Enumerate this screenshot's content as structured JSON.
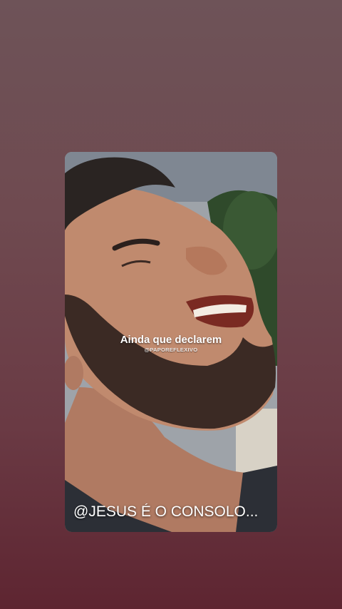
{
  "story": {
    "caption": "Ainda que declarem",
    "credit": "@PAPOREFLEXIVO",
    "footer_text": "@JESUS É O CONSOLO..."
  },
  "colors": {
    "background_top": "#6e5358",
    "background_bottom": "#5e2531",
    "caption_text": "#ffffff"
  }
}
